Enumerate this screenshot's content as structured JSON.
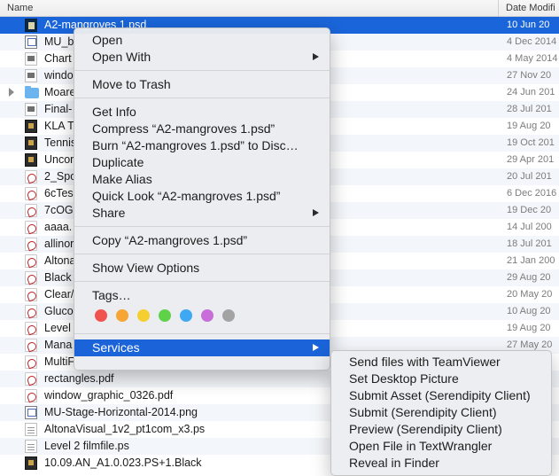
{
  "header": {
    "name_label": "Name",
    "date_label": "Date Modifi"
  },
  "files": [
    {
      "name": "A2-mangroves 1.psd",
      "date": "10 Jun 20",
      "icon": "psd-icon",
      "selected": true
    },
    {
      "name": "MU_b",
      "date": "4 Dec 2014",
      "icon": "window-icon"
    },
    {
      "name": "Chart",
      "date": "4 May 2014",
      "icon": "image-icon"
    },
    {
      "name": "windo",
      "date": "27 Nov 20",
      "icon": "image-icon"
    },
    {
      "name": "Moare",
      "date": "24 Jun 201",
      "icon": "folder-icon",
      "folder": true
    },
    {
      "name": "Final-",
      "date": "28 Jul 201",
      "icon": "image-icon"
    },
    {
      "name": "KLA T",
      "date": "19 Aug 20",
      "icon": "dark-image-icon"
    },
    {
      "name": "Tennis",
      "date": "19 Oct 201",
      "icon": "dark-image-icon"
    },
    {
      "name": "Uncor",
      "date": "29 Apr 201",
      "icon": "dark-image-icon"
    },
    {
      "name": "2_Spo",
      "date": "20 Jul 201",
      "icon": "pdf-icon"
    },
    {
      "name": "6cTes",
      "date": "6 Dec 2016",
      "icon": "pdf-icon"
    },
    {
      "name": "7cOG",
      "date": "19 Dec 20",
      "icon": "pdf-icon"
    },
    {
      "name": "aaaa.",
      "date": "14 Jul 200",
      "icon": "pdf-icon"
    },
    {
      "name": "allinor",
      "date": "18 Jul 201",
      "icon": "pdf-icon"
    },
    {
      "name": "Altona",
      "date": "21 Jan 200",
      "icon": "pdf-icon"
    },
    {
      "name": "Black",
      "date": "29 Aug 20",
      "icon": "pdf-icon"
    },
    {
      "name": "Clear/",
      "date": "20 May 20",
      "icon": "pdf-icon"
    },
    {
      "name": "Gluco",
      "date": "10 Aug 20",
      "icon": "pdf-icon"
    },
    {
      "name": "Level",
      "date": "19 Aug 20",
      "icon": "pdf-icon"
    },
    {
      "name": "Mana",
      "date": "27 May 20",
      "icon": "pdf-icon"
    },
    {
      "name": "MultiF",
      "date": "",
      "icon": "pdf-icon"
    },
    {
      "name": "rectangles.pdf",
      "date": "",
      "icon": "pdf-icon"
    },
    {
      "name": "window_graphic_0326.pdf",
      "date": "",
      "icon": "pdf-icon"
    },
    {
      "name": "MU-Stage-Horizontal-2014.png",
      "date": "",
      "icon": "window-icon"
    },
    {
      "name": "AltonaVisual_1v2_pt1com_x3.ps",
      "date": "",
      "icon": "ps-icon"
    },
    {
      "name": "Level 2 filmfile.ps",
      "date": "",
      "icon": "ps-icon"
    },
    {
      "name": "10.09.AN_A1.0.023.PS+1.Black",
      "date": "",
      "icon": "dark-image-icon"
    }
  ],
  "context_menu": {
    "open": "Open",
    "open_with": "Open With",
    "move_to_trash": "Move to Trash",
    "get_info": "Get Info",
    "compress": "Compress “A2-mangroves 1.psd”",
    "burn": "Burn “A2-mangroves 1.psd” to Disc…",
    "duplicate": "Duplicate",
    "make_alias": "Make Alias",
    "quick_look": "Quick Look “A2-mangroves 1.psd”",
    "share": "Share",
    "copy": "Copy “A2-mangroves 1.psd”",
    "show_view_options": "Show View Options",
    "tags": "Tags…",
    "services": "Services",
    "tag_colors": [
      {
        "name": "red",
        "color": "#f0524f"
      },
      {
        "name": "orange",
        "color": "#f7a534"
      },
      {
        "name": "yellow",
        "color": "#f5cf2f"
      },
      {
        "name": "green",
        "color": "#5fd24a"
      },
      {
        "name": "blue",
        "color": "#3ea8f3"
      },
      {
        "name": "purple",
        "color": "#c76ed8"
      },
      {
        "name": "gray",
        "color": "#a3a3a3"
      }
    ]
  },
  "services_menu": [
    "Send files with TeamViewer",
    "Set Desktop Picture",
    "Submit Asset (Serendipity Client)",
    "Submit (Serendipity Client)",
    "Preview (Serendipity Client)",
    "Open File in TextWrangler",
    "Reveal in Finder"
  ]
}
